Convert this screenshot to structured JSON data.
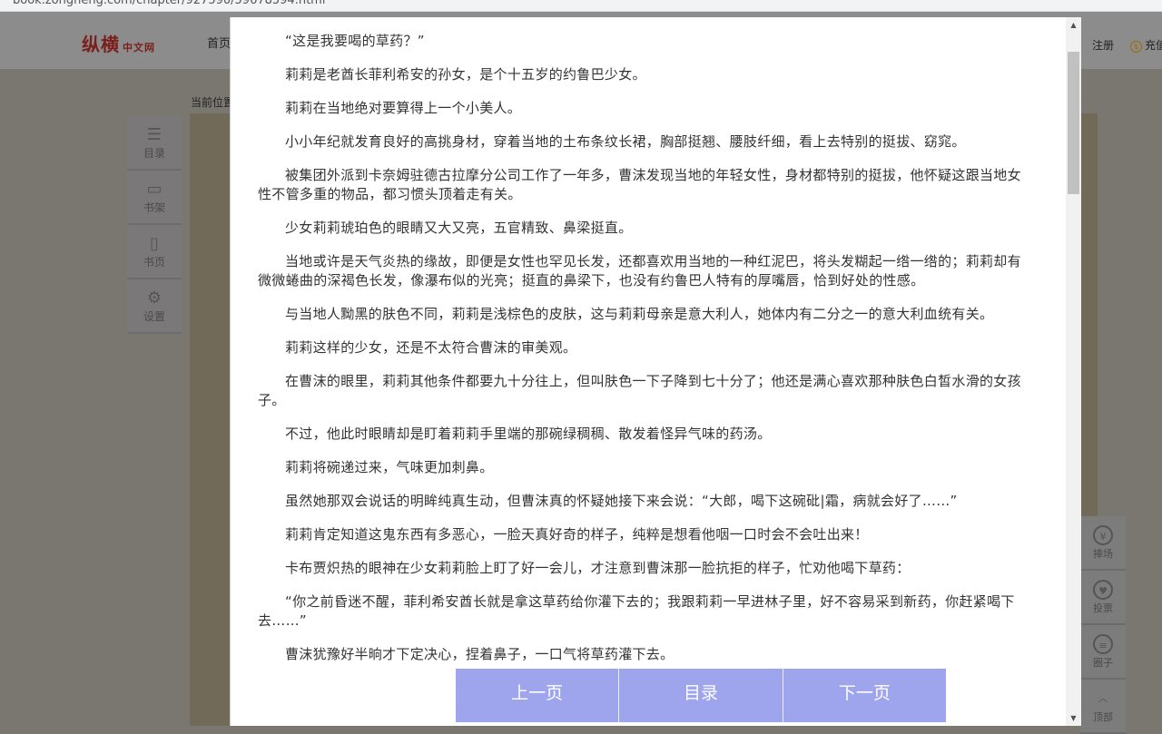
{
  "browser": {
    "url": "book.zongheng.com/chapter/927590/59678594.html"
  },
  "header": {
    "logo": "纵横",
    "logo_sub": "中文网",
    "nav_home": "首页",
    "register": "注册",
    "recharge": "充值"
  },
  "breadcrumb": "当前位置",
  "left_tools": [
    {
      "icon": "list-icon",
      "label": "目录"
    },
    {
      "icon": "bookshelf-icon",
      "label": "书架"
    },
    {
      "icon": "book-page-icon",
      "label": "书页"
    },
    {
      "icon": "gear-icon",
      "label": "设置"
    }
  ],
  "right_tools": [
    {
      "icon": "yuan-icon",
      "glyph": "¥",
      "label": "捧场"
    },
    {
      "icon": "ticket-icon",
      "glyph": "♥",
      "label": "投票"
    },
    {
      "icon": "comment-icon",
      "glyph": "≡",
      "label": "圈子"
    },
    {
      "icon": "chevron-up-icon",
      "glyph": "︿",
      "label": "顶部"
    }
  ],
  "paragraphs": [
    "“这是我要喝的草药？”",
    "莉莉是老酋长菲利希安的孙女，是个十五岁的约鲁巴少女。",
    "莉莉在当地绝对要算得上一个小美人。",
    "小小年纪就发育良好的高挑身材，穿着当地的土布条纹长裙，胸部挺翘、腰肢纤细，看上去特别的挺拔、窈窕。",
    "被集团外派到卡奈姆驻德古拉摩分公司工作了一年多，曹沫发现当地的年轻女性，身材都特别的挺拔，他怀疑这跟当地女性不管多重的物品，都习惯头顶着走有关。",
    "少女莉莉琥珀色的眼睛又大又亮，五官精致、鼻梁挺直。",
    "当地或许是天气炎热的缘故，即便是女性也罕见长发，还都喜欢用当地的一种红泥巴，将头发糊起一绺一绺的；莉莉却有微微蜷曲的深褐色长发，像瀑布似的光亮；挺直的鼻梁下，也没有约鲁巴人特有的厚嘴唇，恰到好处的性感。",
    "与当地人黝黑的肤色不同，莉莉是浅棕色的皮肤，这与莉莉母亲是意大利人，她体内有二分之一的意大利血统有关。",
    "莉莉这样的少女，还是不太符合曹沫的审美观。",
    "在曹沫的眼里，莉莉其他条件都要九十分往上，但叫肤色一下子降到七十分了；他还是满心喜欢那种肤色白皙水滑的女孩子。",
    "不过，他此时眼睛却是盯着莉莉手里端的那碗绿稠稠、散发着怪异气味的药汤。",
    "莉莉将碗递过来，气味更加刺鼻。",
    "虽然她那双会说话的明眸纯真生动，但曹沫真的怀疑她接下来会说：“大郎，喝下这碗砒|霜，病就会好了……”",
    "莉莉肯定知道这鬼东西有多恶心，一脸天真好奇的样子，纯粹是想看他咽一口时会不会吐出来！",
    "卡布贾炽热的眼神在少女莉莉脸上盯了好一会儿，才注意到曹沫那一脸抗拒的样子，忙劝他喝下草药：",
    "“你之前昏迷不醒，菲利希安酋长就是拿这草药给你灌下去的；我跟莉莉一早进林子里，好不容易采到新药，你赶紧喝下去……”",
    "曹沫犹豫好半晌才下定决心，捏着鼻子，一口气将草药灌下去。"
  ],
  "pager": {
    "prev": "上一页",
    "toc": "目录",
    "next": "下一页"
  }
}
